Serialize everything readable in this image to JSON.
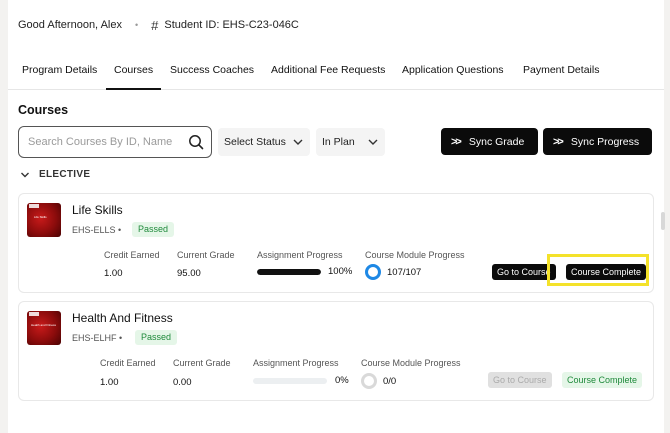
{
  "header": {
    "greeting": "Good Afternoon, Alex",
    "separator": "•",
    "student_id": "Student ID: EHS-C23-046C"
  },
  "tabs": [
    {
      "label": "Program Details"
    },
    {
      "label": "Courses"
    },
    {
      "label": "Success Coaches"
    },
    {
      "label": "Additional Fee Requests"
    },
    {
      "label": "Application Questions"
    },
    {
      "label": "Payment Details"
    }
  ],
  "active_tab": "Courses",
  "section_title": "Courses",
  "search": {
    "placeholder": "Search Courses By ID, Name",
    "value": ""
  },
  "filters": {
    "status": "Select Status",
    "plan": "In Plan"
  },
  "actions": {
    "sync_grade": "Sync Grade",
    "sync_progress": "Sync Progress"
  },
  "group": {
    "label": "ELECTIVE"
  },
  "column_labels": {
    "credit": "Credit Earned",
    "grade": "Current Grade",
    "assignment": "Assignment Progress",
    "module": "Course Module Progress"
  },
  "courses": [
    {
      "name": "Life Skills",
      "thumb_text": "Life Skills",
      "code": "EHS-ELLS",
      "dot": "•",
      "status": "Passed",
      "credit_earned": "1.00",
      "current_grade": "95.00",
      "assignment_progress_pct": "100%",
      "assignment_fraction": 1.0,
      "module_progress": "107/107",
      "module_fraction": 1.0,
      "go_button": "Go to Course",
      "complete_button": "Course Complete"
    },
    {
      "name": "Health And Fitness",
      "thumb_text": "Health and Fitness",
      "code": "EHS-ELHF",
      "dot": "•",
      "status": "Passed",
      "credit_earned": "1.00",
      "current_grade": "0.00",
      "assignment_progress_pct": "0%",
      "assignment_fraction": 0.0,
      "module_progress": "0/0",
      "module_fraction": 0.0,
      "go_button": "Go to Course",
      "complete_button": "Course Complete"
    }
  ],
  "colors": {
    "accent_dark": "#0b0b0b",
    "passed_green": "#1f8a3b",
    "passed_bg": "#e5f6e8",
    "ring_blue": "#1e88e5",
    "highlight_yellow": "#f4e22a"
  }
}
